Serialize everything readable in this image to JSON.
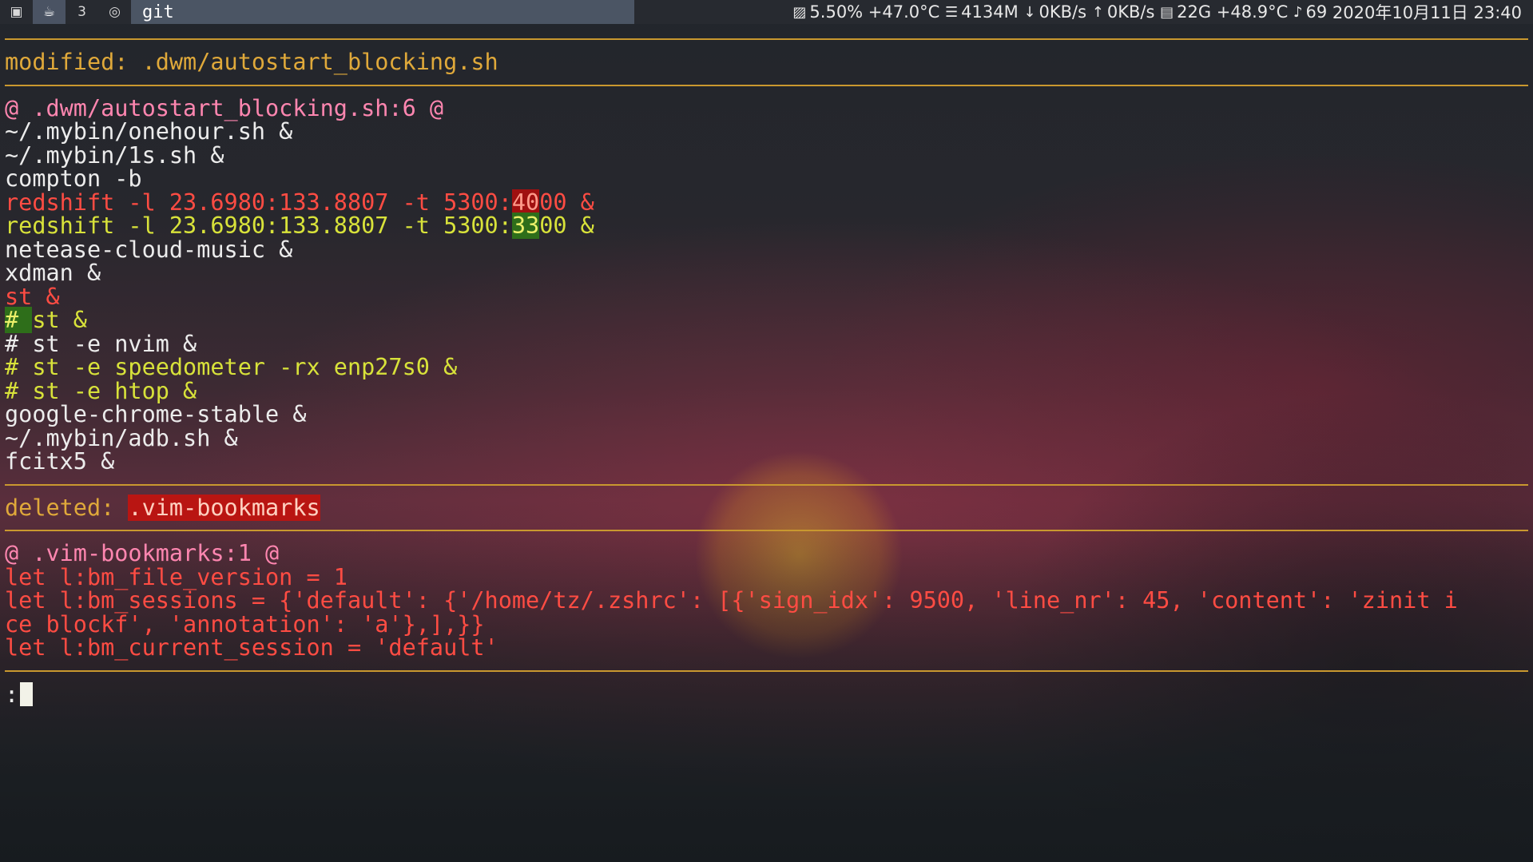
{
  "topbar": {
    "tags": [
      {
        "icon": "terminal-icon",
        "glyph": "▣"
      },
      {
        "icon": "cup-icon",
        "glyph": "☕"
      },
      {
        "icon": "tag-3-icon",
        "glyph": "3"
      },
      {
        "icon": "eye-icon",
        "glyph": "◎"
      }
    ],
    "window_title": "git",
    "status": {
      "cpu_icon": "cpu-icon",
      "cpu": "5.50% +47.0°C",
      "mem_icon": "memory-icon",
      "mem": "4134M",
      "down_icon": "arrow-down-icon",
      "down": "0KB/s",
      "up_icon": "arrow-up-icon",
      "up": "0KB/s",
      "disk_icon": "disk-icon",
      "disk": "22G +48.9°C",
      "bell_icon": "bell-icon",
      "notifications": "69",
      "datetime": "2020年10月11日 23:40"
    }
  },
  "diff": {
    "file1": {
      "header": "modified: .dwm/autostart_blocking.sh",
      "hunk": "@ .dwm/autostart_blocking.sh:6 @",
      "context_before": [
        "~/.mybin/onehour.sh &",
        "~/.mybin/1s.sh &",
        "compton -b"
      ],
      "del1": {
        "a": "redshift -l 23.6980:133.8807 -t 5300:",
        "hl": "40",
        "b": "00 &"
      },
      "add1": {
        "a": "redshift -l 23.6980:133.8807 -t 5300:",
        "hl": "33",
        "b": "00 &"
      },
      "context_mid": [
        "netease-cloud-music &",
        "xdman &"
      ],
      "del2": "st &",
      "add2": {
        "hl": "# ",
        "b": "st &"
      },
      "context_comment": "# st -e nvim &",
      "add_lines": [
        "# st -e speedometer -rx enp27s0 &",
        "# st -e htop &"
      ],
      "context_after": [
        "google-chrome-stable &",
        "~/.mybin/adb.sh &",
        "fcitx5 &"
      ]
    },
    "file2": {
      "label": "deleted: ",
      "name": ".vim-bookmarks",
      "hunk": "@ .vim-bookmarks:1 @",
      "lines": [
        "let l:bm_file_version = 1",
        "let l:bm_sessions = {'default': {'/home/tz/.zshrc': [{'sign_idx': 9500, 'line_nr': 45, 'content': 'zinit i",
        "ce blockf', 'annotation': 'a'},],}}",
        "let l:bm_current_session = 'default'"
      ]
    },
    "prompt": ":"
  }
}
